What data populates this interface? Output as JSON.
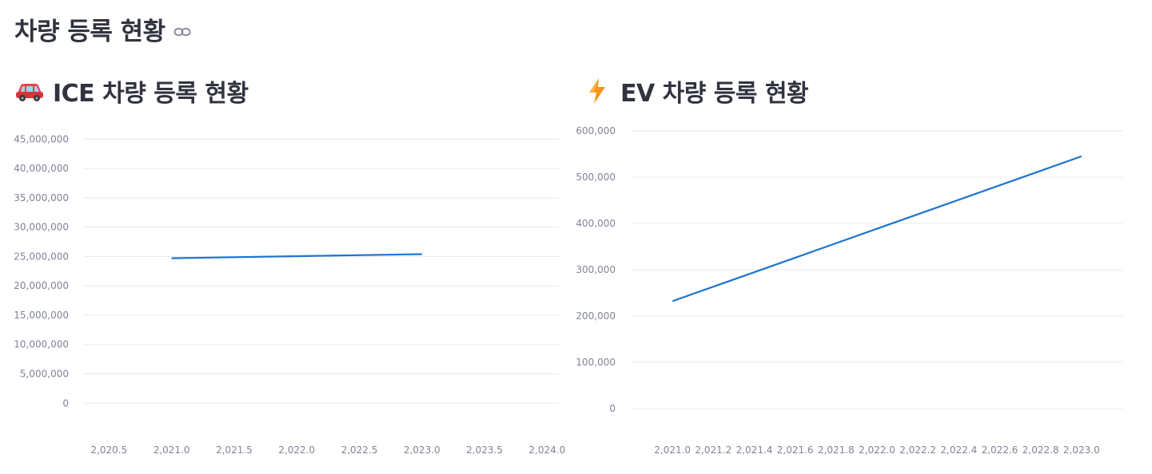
{
  "page": {
    "title": "차량 등록 현황",
    "link_icon": "link-icon"
  },
  "ice_panel": {
    "heading": "ICE 차량 등록 현황",
    "icon": "car-icon"
  },
  "ev_panel": {
    "heading": "EV 차량 등록 현황",
    "icon": "lightning-icon"
  },
  "colors": {
    "line": "#1c74d0",
    "grid": "#e6e9ef",
    "tick_text": "#808495",
    "title_text": "#31333f"
  },
  "chart_data": [
    {
      "type": "line",
      "title": "",
      "xlabel": "",
      "ylabel": "",
      "x": [
        2021.0,
        2023.0
      ],
      "series": [
        {
          "values": [
            24700000,
            25400000
          ]
        }
      ],
      "xlim": [
        2020.3,
        2024.1
      ],
      "ylim": [
        -3500000,
        46000000
      ],
      "x_ticks": [
        2020.5,
        2021.0,
        2021.5,
        2022.0,
        2022.5,
        2023.0,
        2023.5,
        2024.0
      ],
      "x_tick_labels": [
        "2,020.5",
        "2,021.0",
        "2,021.5",
        "2,022.0",
        "2,022.5",
        "2,023.0",
        "2,023.5",
        "2,024.0"
      ],
      "y_ticks": [
        0,
        5000000,
        10000000,
        15000000,
        20000000,
        25000000,
        30000000,
        35000000,
        40000000,
        45000000
      ],
      "y_tick_labels": [
        "0",
        "5,000,000",
        "10,000,000",
        "15,000,000",
        "20,000,000",
        "25,000,000",
        "30,000,000",
        "35,000,000",
        "40,000,000",
        "45,000,000"
      ],
      "grid": true,
      "legend": "none"
    },
    {
      "type": "line",
      "title": "",
      "xlabel": "",
      "ylabel": "",
      "x": [
        2021.0,
        2023.0
      ],
      "series": [
        {
          "values": [
            232000,
            545000
          ]
        }
      ],
      "xlim": [
        2020.8,
        2023.2
      ],
      "ylim": [
        0,
        600000
      ],
      "x_ticks": [
        2021.0,
        2021.2,
        2021.4,
        2021.6,
        2021.8,
        2022.0,
        2022.2,
        2022.4,
        2022.6,
        2022.8,
        2023.0
      ],
      "x_tick_labels": [
        "2,021.0",
        "2,021.2",
        "2,021.4",
        "2,021.6",
        "2,021.8",
        "2,022.0",
        "2,022.2",
        "2,022.4",
        "2,022.6",
        "2,022.8",
        "2,023.0"
      ],
      "y_ticks": [
        0,
        100000,
        200000,
        300000,
        400000,
        500000,
        600000
      ],
      "y_tick_labels": [
        "0",
        "100,000",
        "200,000",
        "300,000",
        "400,000",
        "500,000",
        "600,000"
      ],
      "grid": true,
      "legend": "none"
    }
  ]
}
